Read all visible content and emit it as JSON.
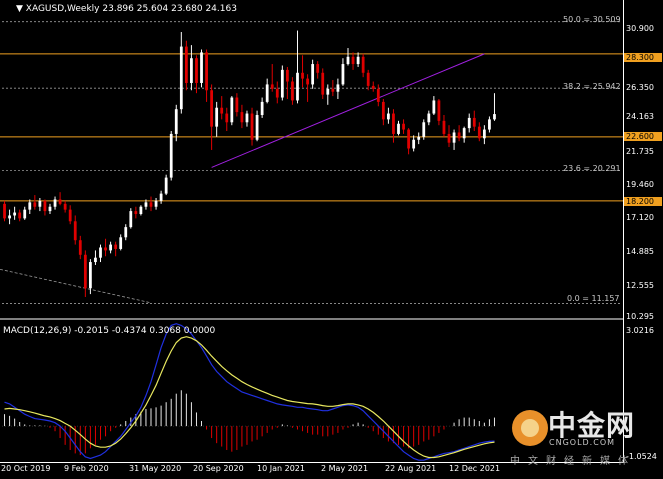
{
  "window": {
    "symbol_label": "XAGUSD,Weekly",
    "ohlc": "23.896 25.604 23.680 24.163",
    "macd_label": "MACD(12,26,9) -0.2015 -0.4374 0.3068 0.0000"
  },
  "price_axis": {
    "labels": [
      "30.900",
      "26.350",
      "24.163",
      "21.735",
      "19.460",
      "17.120",
      "14.885",
      "12.555",
      "10.295"
    ],
    "boxed": [
      "28.300",
      "22.600",
      "18.200"
    ]
  },
  "macd_axis": {
    "top": "3.0216",
    "bottom": "-1.0524"
  },
  "time_axis": [
    "20 Oct 2019",
    "9 Feb 2020",
    "31 May 2020",
    "20 Sep 2020",
    "10 Jan 2021",
    "2 May 2021",
    "22 Aug 2021",
    "12 Dec 2021"
  ],
  "fibo": {
    "levels": [
      "50.0 = 30.509",
      "38.2 = 25.942",
      "23.6 = 20.291",
      "0.0 = 11.157"
    ]
  },
  "colors": {
    "bull": "#ffffff",
    "bear": "#e00000",
    "support": "#f0a020",
    "trend": "#a020e0",
    "macd_main": "#2030e0",
    "macd_signal": "#e8e860"
  },
  "icons": {
    "menu": "triangle-down-icon",
    "logo": "cngold-logo-icon"
  },
  "logo": {
    "zh": "中金网",
    "en": "CNGOLD.COM",
    "sub": "中文财经新媒体"
  },
  "chart_data": {
    "type": "candlestick",
    "title": "XAGUSD,Weekly",
    "ylim": [
      10.295,
      30.9
    ],
    "candles": [
      [
        18.0,
        18.2,
        16.8,
        17.0
      ],
      [
        17.0,
        17.6,
        16.6,
        17.2
      ],
      [
        17.2,
        17.8,
        16.9,
        17.4
      ],
      [
        17.4,
        17.6,
        16.8,
        17.0
      ],
      [
        17.0,
        17.8,
        16.9,
        17.6
      ],
      [
        17.6,
        18.3,
        17.3,
        18.1
      ],
      [
        18.1,
        18.6,
        17.6,
        17.8
      ],
      [
        17.8,
        18.4,
        17.5,
        18.2
      ],
      [
        18.2,
        18.3,
        17.2,
        17.5
      ],
      [
        17.5,
        18.0,
        17.3,
        17.8
      ],
      [
        17.8,
        18.5,
        17.6,
        18.3
      ],
      [
        18.3,
        18.8,
        17.9,
        18.0
      ],
      [
        18.0,
        18.2,
        17.4,
        17.6
      ],
      [
        17.6,
        17.9,
        16.6,
        16.8
      ],
      [
        16.8,
        17.2,
        15.2,
        15.5
      ],
      [
        15.5,
        15.8,
        14.2,
        14.5
      ],
      [
        14.5,
        14.8,
        11.6,
        12.2
      ],
      [
        12.2,
        14.2,
        11.8,
        14.0
      ],
      [
        14.0,
        14.8,
        13.8,
        14.3
      ],
      [
        14.3,
        15.2,
        14.0,
        15.0
      ],
      [
        15.0,
        15.6,
        14.4,
        14.8
      ],
      [
        14.8,
        15.4,
        14.6,
        15.2
      ],
      [
        15.2,
        15.4,
        14.4,
        14.9
      ],
      [
        14.9,
        15.9,
        14.8,
        15.7
      ],
      [
        15.7,
        16.6,
        15.5,
        16.4
      ],
      [
        16.4,
        17.7,
        16.3,
        17.5
      ],
      [
        17.5,
        17.8,
        17.0,
        17.3
      ],
      [
        17.3,
        17.9,
        17.2,
        17.8
      ],
      [
        17.8,
        18.3,
        17.6,
        18.1
      ],
      [
        18.1,
        18.5,
        17.5,
        17.8
      ],
      [
        17.8,
        18.4,
        17.6,
        18.2
      ],
      [
        18.2,
        18.9,
        18.0,
        18.7
      ],
      [
        18.7,
        20.0,
        18.6,
        19.8
      ],
      [
        19.8,
        23.0,
        19.6,
        22.8
      ],
      [
        22.8,
        24.8,
        22.3,
        24.5
      ],
      [
        24.5,
        29.8,
        24.2,
        28.8
      ],
      [
        28.8,
        29.2,
        25.8,
        26.3
      ],
      [
        26.3,
        28.9,
        25.8,
        28.0
      ],
      [
        28.0,
        28.2,
        25.6,
        26.3
      ],
      [
        26.3,
        28.6,
        26.0,
        28.4
      ],
      [
        28.4,
        28.6,
        25.0,
        25.8
      ],
      [
        25.8,
        26.2,
        21.7,
        23.3
      ],
      [
        23.3,
        25.0,
        22.6,
        24.6
      ],
      [
        24.6,
        25.4,
        23.8,
        24.2
      ],
      [
        24.2,
        24.6,
        23.0,
        23.6
      ],
      [
        23.6,
        25.4,
        23.4,
        25.3
      ],
      [
        25.3,
        25.6,
        24.0,
        24.3
      ],
      [
        24.3,
        24.8,
        23.2,
        23.6
      ],
      [
        23.6,
        24.4,
        23.3,
        24.2
      ],
      [
        24.2,
        24.6,
        22.0,
        22.4
      ],
      [
        22.4,
        24.4,
        22.3,
        24.1
      ],
      [
        24.1,
        25.3,
        23.9,
        25.0
      ],
      [
        25.0,
        26.6,
        24.9,
        26.2
      ],
      [
        26.2,
        27.6,
        25.7,
        25.9
      ],
      [
        25.9,
        26.4,
        24.9,
        25.3
      ],
      [
        25.3,
        27.5,
        25.1,
        27.2
      ],
      [
        27.2,
        27.4,
        25.2,
        26.4
      ],
      [
        26.4,
        26.7,
        24.8,
        25.1
      ],
      [
        25.1,
        29.9,
        24.9,
        27.0
      ],
      [
        27.0,
        28.2,
        26.0,
        26.6
      ],
      [
        26.6,
        26.9,
        25.0,
        26.2
      ],
      [
        26.2,
        27.9,
        25.9,
        27.6
      ],
      [
        27.6,
        27.8,
        26.6,
        27.0
      ],
      [
        27.0,
        27.3,
        25.2,
        25.5
      ],
      [
        25.5,
        26.2,
        24.8,
        25.9
      ],
      [
        25.9,
        26.5,
        25.4,
        25.7
      ],
      [
        25.7,
        26.6,
        25.2,
        26.2
      ],
      [
        26.2,
        28.0,
        26.1,
        27.6
      ],
      [
        27.6,
        28.7,
        27.5,
        28.1
      ],
      [
        28.1,
        28.4,
        27.2,
        27.6
      ],
      [
        27.6,
        28.4,
        27.4,
        28.1
      ],
      [
        28.1,
        28.3,
        26.7,
        27.0
      ],
      [
        27.0,
        27.2,
        25.8,
        26.1
      ],
      [
        26.1,
        26.4,
        25.7,
        25.9
      ],
      [
        25.9,
        26.2,
        24.7,
        25.0
      ],
      [
        25.0,
        25.2,
        23.4,
        23.8
      ],
      [
        23.8,
        24.6,
        23.5,
        24.2
      ],
      [
        24.2,
        24.5,
        22.2,
        22.8
      ],
      [
        22.8,
        23.7,
        22.7,
        23.5
      ],
      [
        23.5,
        23.8,
        22.8,
        23.1
      ],
      [
        23.1,
        23.2,
        21.4,
        21.8
      ],
      [
        21.8,
        22.7,
        21.6,
        22.4
      ],
      [
        22.4,
        22.9,
        22.1,
        22.6
      ],
      [
        22.6,
        23.8,
        22.4,
        23.6
      ],
      [
        23.6,
        24.4,
        23.4,
        24.2
      ],
      [
        24.2,
        25.4,
        24.1,
        25.1
      ],
      [
        25.1,
        25.2,
        23.4,
        23.7
      ],
      [
        23.7,
        24.1,
        22.6,
        22.8
      ],
      [
        22.8,
        23.4,
        21.9,
        22.2
      ],
      [
        22.2,
        23.1,
        21.7,
        22.9
      ],
      [
        22.9,
        23.4,
        22.3,
        22.5
      ],
      [
        22.5,
        23.3,
        22.2,
        23.2
      ],
      [
        23.2,
        24.2,
        22.9,
        23.9
      ],
      [
        23.9,
        24.4,
        23.0,
        23.3
      ],
      [
        23.3,
        23.6,
        22.3,
        22.5
      ],
      [
        22.5,
        23.4,
        22.1,
        23.1
      ],
      [
        23.1,
        24.0,
        22.9,
        23.8
      ],
      [
        23.8,
        25.6,
        23.7,
        24.163
      ]
    ],
    "macd": {
      "hist": [
        0.35,
        0.3,
        0.22,
        0.12,
        0.05,
        0.02,
        0.02,
        0.02,
        0.01,
        -0.05,
        -0.15,
        -0.35,
        -0.55,
        -0.7,
        -0.8,
        -0.85,
        -0.8,
        -0.65,
        -0.55,
        -0.4,
        -0.3,
        -0.15,
        -0.05,
        0.05,
        0.15,
        0.25,
        0.35,
        0.42,
        0.5,
        0.52,
        0.55,
        0.6,
        0.7,
        0.8,
        0.95,
        1.05,
        0.95,
        0.7,
        0.4,
        0.15,
        -0.1,
        -0.35,
        -0.5,
        -0.6,
        -0.7,
        -0.75,
        -0.7,
        -0.6,
        -0.55,
        -0.45,
        -0.4,
        -0.3,
        -0.2,
        -0.1,
        -0.05,
        0.05,
        0.02,
        -0.05,
        -0.1,
        -0.15,
        -0.2,
        -0.25,
        -0.25,
        -0.3,
        -0.3,
        -0.25,
        -0.2,
        -0.1,
        -0.05,
        0.05,
        0.1,
        0.05,
        -0.05,
        -0.15,
        -0.25,
        -0.35,
        -0.45,
        -0.5,
        -0.55,
        -0.6,
        -0.65,
        -0.6,
        -0.55,
        -0.45,
        -0.4,
        -0.3,
        -0.2,
        -0.1,
        0.0,
        0.1,
        0.2,
        0.25,
        0.25,
        0.2,
        0.15,
        0.1,
        0.2,
        0.25
      ],
      "main": [
        0.7,
        0.65,
        0.55,
        0.45,
        0.35,
        0.28,
        0.22,
        0.2,
        0.18,
        0.15,
        0.1,
        0.0,
        -0.15,
        -0.35,
        -0.55,
        -0.75,
        -0.9,
        -0.95,
        -0.9,
        -0.85,
        -0.75,
        -0.6,
        -0.45,
        -0.3,
        -0.1,
        0.1,
        0.3,
        0.55,
        0.9,
        1.3,
        1.8,
        2.3,
        2.7,
        2.95,
        3.0,
        2.95,
        2.85,
        2.7,
        2.5,
        2.3,
        2.05,
        1.8,
        1.6,
        1.45,
        1.3,
        1.2,
        1.1,
        1.0,
        0.95,
        0.9,
        0.85,
        0.8,
        0.75,
        0.7,
        0.65,
        0.62,
        0.6,
        0.58,
        0.55,
        0.55,
        0.52,
        0.5,
        0.48,
        0.45,
        0.45,
        0.5,
        0.55,
        0.6,
        0.62,
        0.6,
        0.55,
        0.45,
        0.3,
        0.15,
        0.0,
        -0.15,
        -0.3,
        -0.45,
        -0.6,
        -0.75,
        -0.85,
        -0.95,
        -1.0,
        -1.0,
        -0.95,
        -0.9,
        -0.85,
        -0.8,
        -0.78,
        -0.75,
        -0.7,
        -0.65,
        -0.6,
        -0.55,
        -0.5,
        -0.47,
        -0.45,
        -0.44
      ],
      "signal": [
        0.5,
        0.52,
        0.5,
        0.48,
        0.45,
        0.42,
        0.38,
        0.34,
        0.3,
        0.27,
        0.22,
        0.16,
        0.08,
        0.0,
        -0.12,
        -0.25,
        -0.38,
        -0.5,
        -0.58,
        -0.62,
        -0.62,
        -0.58,
        -0.5,
        -0.38,
        -0.22,
        -0.05,
        0.15,
        0.38,
        0.62,
        0.9,
        1.2,
        1.55,
        1.9,
        2.2,
        2.45,
        2.58,
        2.62,
        2.58,
        2.5,
        2.38,
        2.22,
        2.05,
        1.9,
        1.75,
        1.62,
        1.5,
        1.4,
        1.3,
        1.22,
        1.15,
        1.08,
        1.02,
        0.96,
        0.9,
        0.85,
        0.8,
        0.75,
        0.72,
        0.7,
        0.68,
        0.66,
        0.65,
        0.63,
        0.6,
        0.58,
        0.58,
        0.6,
        0.63,
        0.65,
        0.65,
        0.62,
        0.58,
        0.5,
        0.4,
        0.28,
        0.15,
        0.0,
        -0.15,
        -0.3,
        -0.45,
        -0.58,
        -0.7,
        -0.8,
        -0.88,
        -0.92,
        -0.92,
        -0.9,
        -0.86,
        -0.82,
        -0.78,
        -0.73,
        -0.68,
        -0.64,
        -0.6,
        -0.56,
        -0.52,
        -0.49,
        -0.47
      ],
      "ylim": [
        -1.0524,
        3.0216
      ]
    }
  }
}
